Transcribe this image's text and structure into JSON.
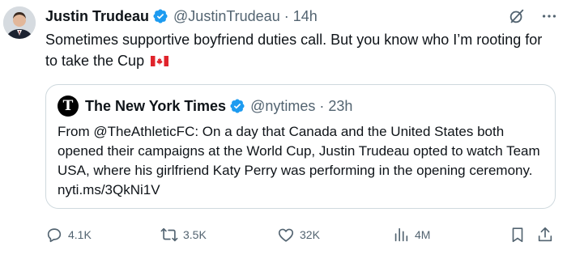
{
  "tweet": {
    "author_name": "Justin Trudeau",
    "author_handle": "@JustinTrudeau",
    "separator": "·",
    "time": "14h",
    "text": "Sometimes supportive boyfriend duties call. But you know who I’m rooting for to take the Cup",
    "flag_emoji": "canadian-flag",
    "verified_color": "#1d9bf0"
  },
  "quote": {
    "author_name": "The New York Times",
    "author_handle": "@nytimes",
    "separator": "·",
    "time": "23h",
    "text": "From @TheAthleticFC: On a day that Canada and the United States both opened their campaigns at the World Cup, Justin Trudeau opted to watch Team USA, where his girlfriend Katy Perry was performing in the opening ceremony. nyti.ms/3QkNi1V",
    "logo_letter": "T"
  },
  "actions": {
    "replies": "4.1K",
    "reposts": "3.5K",
    "likes": "32K",
    "views": "4M"
  },
  "icons": {
    "more": "more-dots-icon",
    "grok": "slash-circle-icon",
    "reply": "reply-icon",
    "repost": "repost-icon",
    "like": "heart-icon",
    "views": "views-icon",
    "bookmark": "bookmark-icon",
    "share": "share-icon"
  },
  "colors": {
    "text": "#0f1419",
    "muted": "#536471",
    "border": "#cfd9de"
  }
}
